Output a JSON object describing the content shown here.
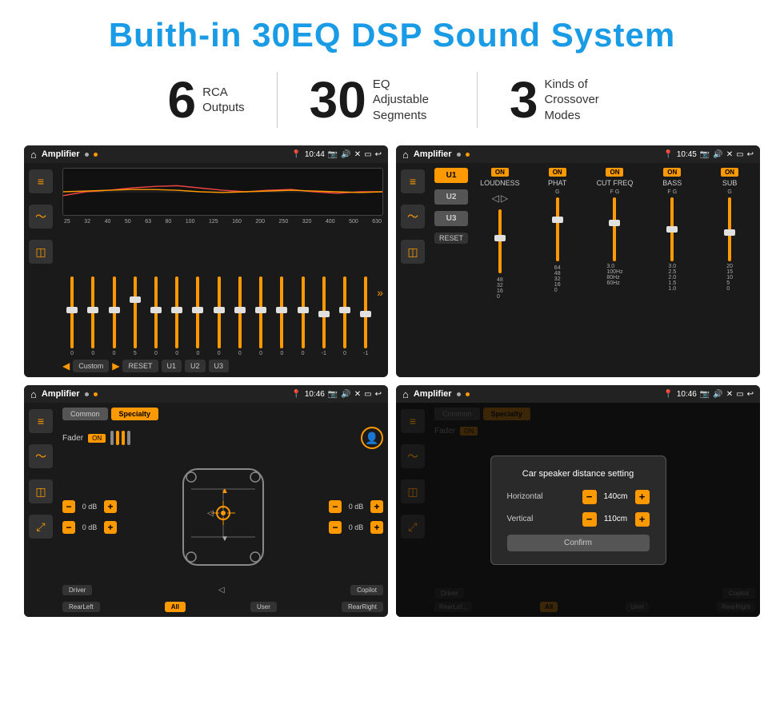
{
  "title": "Buith-in 30EQ DSP Sound System",
  "stats": [
    {
      "number": "6",
      "label": "RCA\nOutputs"
    },
    {
      "number": "30",
      "label": "EQ Adjustable\nSegments"
    },
    {
      "number": "3",
      "label": "Kinds of\nCrossover Modes"
    }
  ],
  "screens": [
    {
      "id": "screen1",
      "status_bar": {
        "app": "Amplifier",
        "time": "10:44"
      },
      "eq_freqs": [
        "25",
        "32",
        "40",
        "50",
        "63",
        "80",
        "100",
        "125",
        "160",
        "200",
        "250",
        "320",
        "400",
        "500",
        "630"
      ],
      "eq_values": [
        "0",
        "0",
        "0",
        "5",
        "0",
        "0",
        "0",
        "0",
        "0",
        "0",
        "0",
        "0",
        "-1",
        "0",
        "-1"
      ],
      "bottom_btns": [
        "Custom",
        "RESET",
        "U1",
        "U2",
        "U3"
      ]
    },
    {
      "id": "screen2",
      "status_bar": {
        "app": "Amplifier",
        "time": "10:45"
      },
      "u_buttons": [
        "U1",
        "U2",
        "U3"
      ],
      "cols": [
        "LOUDNESS",
        "PHAT",
        "CUT FREQ",
        "BASS",
        "SUB"
      ],
      "reset_label": "RESET"
    },
    {
      "id": "screen3",
      "status_bar": {
        "app": "Amplifier",
        "time": "10:46"
      },
      "tabs": [
        "Common",
        "Specialty"
      ],
      "fader_label": "Fader",
      "on_label": "ON",
      "db_values": [
        "0 dB",
        "0 dB",
        "0 dB",
        "0 dB"
      ],
      "bottom_labels": [
        "Driver",
        "",
        "Copilot",
        "RearLeft",
        "All",
        "User",
        "RearRight"
      ]
    },
    {
      "id": "screen4",
      "status_bar": {
        "app": "Amplifier",
        "time": "10:46"
      },
      "tabs": [
        "Common",
        "Specialty"
      ],
      "dialog": {
        "title": "Car speaker distance setting",
        "rows": [
          {
            "label": "Horizontal",
            "value": "140cm"
          },
          {
            "label": "Vertical",
            "value": "110cm"
          }
        ],
        "confirm_label": "Confirm"
      },
      "bottom_labels": [
        "Driver",
        "",
        "Copilot",
        "RearLef...",
        "All",
        "User",
        "RearRight"
      ]
    }
  ]
}
